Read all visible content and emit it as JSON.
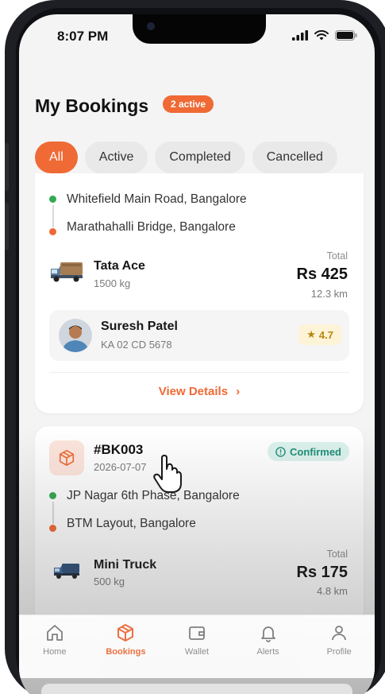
{
  "status_bar": {
    "time": "8:07 PM"
  },
  "header": {
    "title": "My Bookings",
    "badge": "2 active"
  },
  "tabs": [
    {
      "label": "All",
      "active": true
    },
    {
      "label": "Active",
      "active": false
    },
    {
      "label": "Completed",
      "active": false
    },
    {
      "label": "Cancelled",
      "active": false
    }
  ],
  "bookings": [
    {
      "pickup": "Whitefield Main Road, Bangalore",
      "drop": "Marathahalli Bridge, Bangalore",
      "vehicle": {
        "name": "Tata Ace",
        "capacity": "1500 kg"
      },
      "total_label": "Total",
      "price": "Rs 425",
      "distance": "12.3 km",
      "driver": {
        "name": "Suresh Patel",
        "plate": "KA 02 CD 5678",
        "rating": "4.7"
      },
      "action": "View Details"
    },
    {
      "id": "#BK003",
      "date": "2026-07-07",
      "status": "Confirmed",
      "pickup": "JP Nagar 6th Phase, Bangalore",
      "drop": "BTM Layout, Bangalore",
      "vehicle": {
        "name": "Mini Truck",
        "capacity": "500 kg"
      },
      "total_label": "Total",
      "price": "Rs 175",
      "distance": "4.8 km"
    }
  ],
  "nav": [
    {
      "label": "Home",
      "icon": "home-icon",
      "active": false
    },
    {
      "label": "Bookings",
      "icon": "package-icon",
      "active": true
    },
    {
      "label": "Wallet",
      "icon": "wallet-icon",
      "active": false
    },
    {
      "label": "Alerts",
      "icon": "bell-icon",
      "active": false
    },
    {
      "label": "Profile",
      "icon": "user-icon",
      "active": false
    }
  ],
  "colors": {
    "accent": "#ef6a35",
    "confirmed": "#1f8f77",
    "rating": "#b8860b"
  }
}
